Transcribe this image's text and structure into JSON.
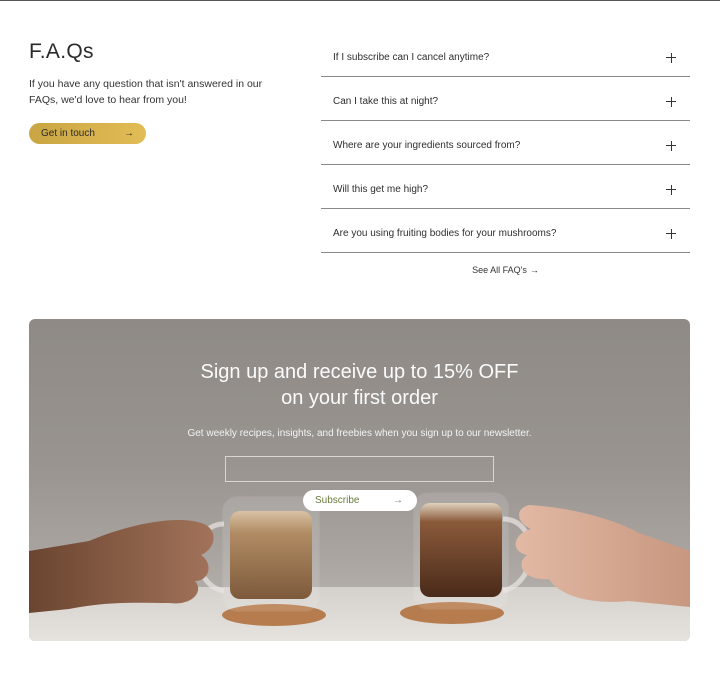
{
  "faq": {
    "title": "F.A.Qs",
    "intro": "If you have any question that isn't answered in our FAQs, we'd love to hear from you!",
    "contact_button": {
      "label": "Get in touch",
      "arrow": "→"
    },
    "items": [
      {
        "question": "If I subscribe can I cancel anytime?"
      },
      {
        "question": "Can I take this at night?"
      },
      {
        "question": "Where are your ingredients sourced from?"
      },
      {
        "question": "Will this get me high?"
      },
      {
        "question": "Are you using fruiting bodies for your mushrooms?"
      }
    ],
    "see_all": {
      "label": "See All FAQ's",
      "arrow": "→"
    }
  },
  "newsletter": {
    "title_line1": "Sign up and receive up to 15% OFF",
    "title_line2": "on your first order",
    "subtitle": "Get weekly recipes, insights, and freebies when you sign up to our newsletter.",
    "email_placeholder": "",
    "subscribe": {
      "label": "Subscribe",
      "arrow": "→"
    },
    "image": "two-hands-toasting-coffee-glass-mugs"
  },
  "colors": {
    "gold_button": "#d8b24d",
    "subscribe_text": "#6a7a3c",
    "divider": "#8a8a8a"
  },
  "icons": [
    "plus-icon",
    "arrow-right-icon"
  ]
}
